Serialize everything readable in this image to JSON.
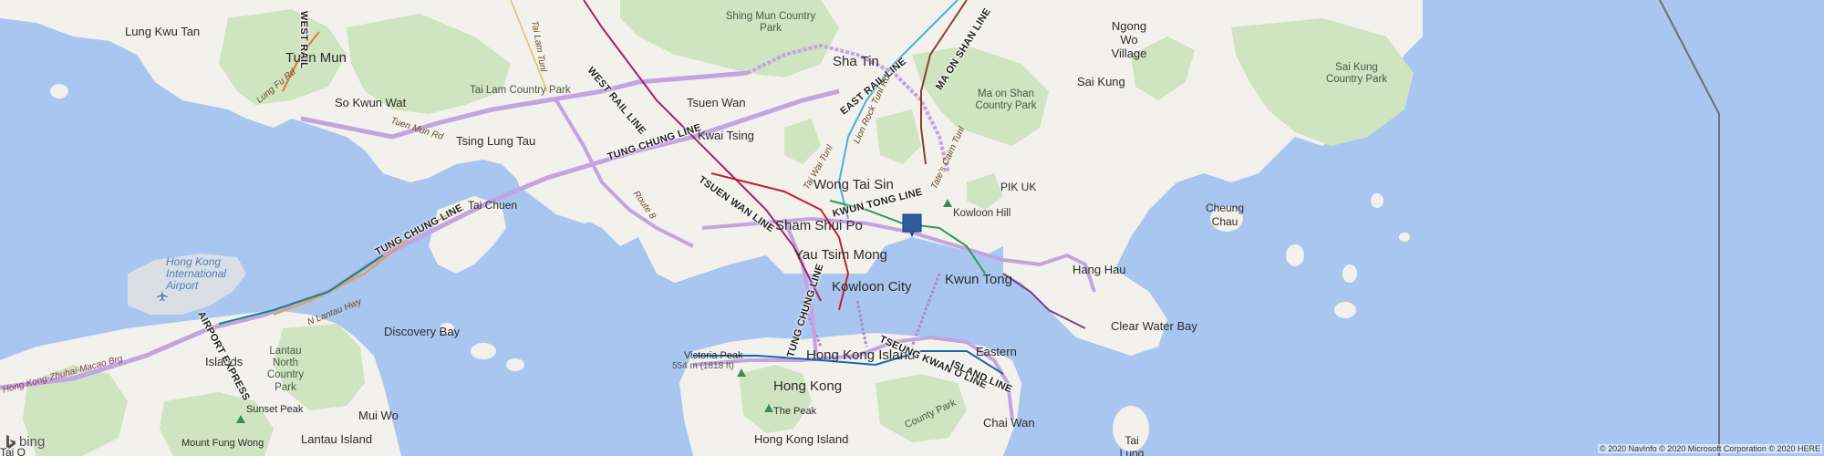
{
  "map": {
    "colors": {
      "water": "#a9c6f1",
      "land": "#f3f1ec",
      "park": "#cfe4c0",
      "mtr": "#b285d6",
      "marker": "#2d5aa0"
    },
    "labels": {
      "lung_kwu_tan": "Lung Kwu Tan",
      "tuen_mun": "Tuen Mun",
      "so_kwun_wat": "So Kwun Wat",
      "tsing_lung_tau": "Tsing Lung Tau",
      "tai_chuen": "Tai Chuen",
      "discovery_bay": "Discovery Bay",
      "islands": "Islands",
      "mui_wo": "Mui Wo",
      "tai_o": "Tai O",
      "tsuen_wan": "Tsuen Wan",
      "kwai_tsing": "Kwai Tsing",
      "sha_tin": "Sha Tin",
      "wong_tai_sin": "Wong Tai Sin",
      "sham_shui_po": "Sham Shui Po",
      "yau_tsim_mong": "Yau Tsim Mong",
      "kowloon_city": "Kowloon City",
      "kwun_tong": "Kwun Tong",
      "hang_hau": "Hang Hau",
      "clear_water_bay": "Clear Water Bay",
      "eastern": "Eastern",
      "chai_wan": "Chai Wan",
      "hong_kong_island": "Hong Kong Island",
      "hong_kong": "Hong Kong",
      "hong_kong_island_south": "Hong Kong Island",
      "sai_kung": "Sai Kung",
      "ngong_wo_village": "Ngong Wo Village",
      "cheung_chau": "Cheung Chau",
      "pik_uk": "PIK UK",
      "tai_lung": "Tai Lung"
    },
    "parks": {
      "shing_mun": "Shing Mun Country Park",
      "tai_lam": "Tai Lam Country Park",
      "ma_on_shan": "Ma on Shan Country Park",
      "sai_kung_country": "Sai Kung Country Park",
      "lantau_north": "Lantau North Country Park",
      "kowloon_hill": "Kowloon Hill",
      "victoria_peak": "Victoria Peak",
      "victoria_peak_height": "554 m (1818 ft)",
      "the_peak": "The Peak",
      "sunset_peak": "Sunset Peak",
      "mount_fung_wong": "Mount Fung Wong",
      "lantau_island": "Lantau Island",
      "county_park": "County Park"
    },
    "airport": "Hong Kong International Airport",
    "rail_lines": {
      "west_rail": "WEST RAIL LINE",
      "east_rail": "EAST RAIL LINE",
      "ma_on_shan": "MA ON SHAN LINE",
      "tung_chung_1": "TUNG CHUNG LINE",
      "tung_chung_2": "TUNG CHUNG LINE",
      "tung_chung_3": "TUNG CHUNG LINE",
      "tsuen_wan": "TSUEN WAN LINE",
      "kwun_tong": "KWUN TONG LINE",
      "tseung_kwan_o": "TSEUNG KWAN O LINE",
      "island": "ISLAND LINE",
      "airport_express": "AIRPORT EXPRESS",
      "west_rail_top": "WEST RAIL"
    },
    "roads": {
      "tuen_mun_rd": "Tuen Mun Rd",
      "lung_fu_rd": "Lung Fu Rd",
      "tai_lam_tunl": "Tai Lam Tunl",
      "route_8": "Route 8",
      "n_lantau_hwy": "N Lantau Hwy",
      "hk_zhuhai_macao": "Hong Kong-Zhuhai-Macao Brg",
      "tai_wai_tunl": "Tai Wai Tunl",
      "lion_rock_tunl": "Lion Rock Tunl Rd",
      "tates_cairn": "Tate's Cairn Tunl"
    },
    "branding": {
      "bing": "bing",
      "copyright": "© 2020 NavInfo © 2020 Microsoft Corporation © 2020 HERE"
    }
  }
}
